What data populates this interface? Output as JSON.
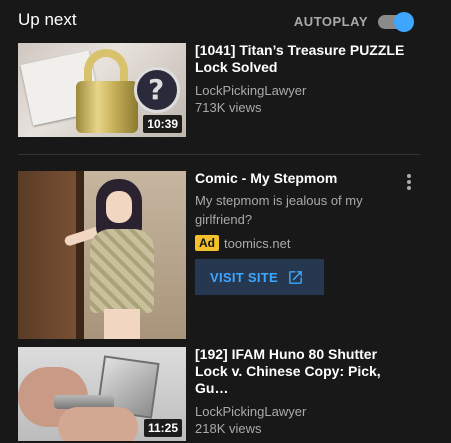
{
  "header": {
    "title": "Up next",
    "autoplay_label": "AUTOPLAY",
    "autoplay_on": true
  },
  "videos": [
    {
      "title_line1": "[1041] Titan’s Treasure PUZZLE",
      "title_line2": "Lock Solved",
      "channel": "LockPickingLawyer",
      "views": "713K views",
      "duration": "10:39"
    },
    {
      "title_line1": "[192] IFAM Huno 80 Shutter",
      "title_line2": "Lock v. Chinese Copy: Pick, Gu…",
      "channel": "LockPickingLawyer",
      "views": "218K views",
      "duration": "11:25"
    }
  ],
  "ad": {
    "title": "Comic - My Stepmom",
    "desc_line1": "My stepmom is jealous of my",
    "desc_line2": "girlfriend?",
    "badge": "Ad",
    "domain": "toomics.net",
    "cta": "VISIT SITE"
  },
  "colors": {
    "background": "#181818",
    "accent": "#3ea6ff",
    "ad_badge": "#f4c02c",
    "secondary_text": "#aaaaaa"
  },
  "icons": [
    "open-in-new-icon",
    "more-vert-icon"
  ]
}
